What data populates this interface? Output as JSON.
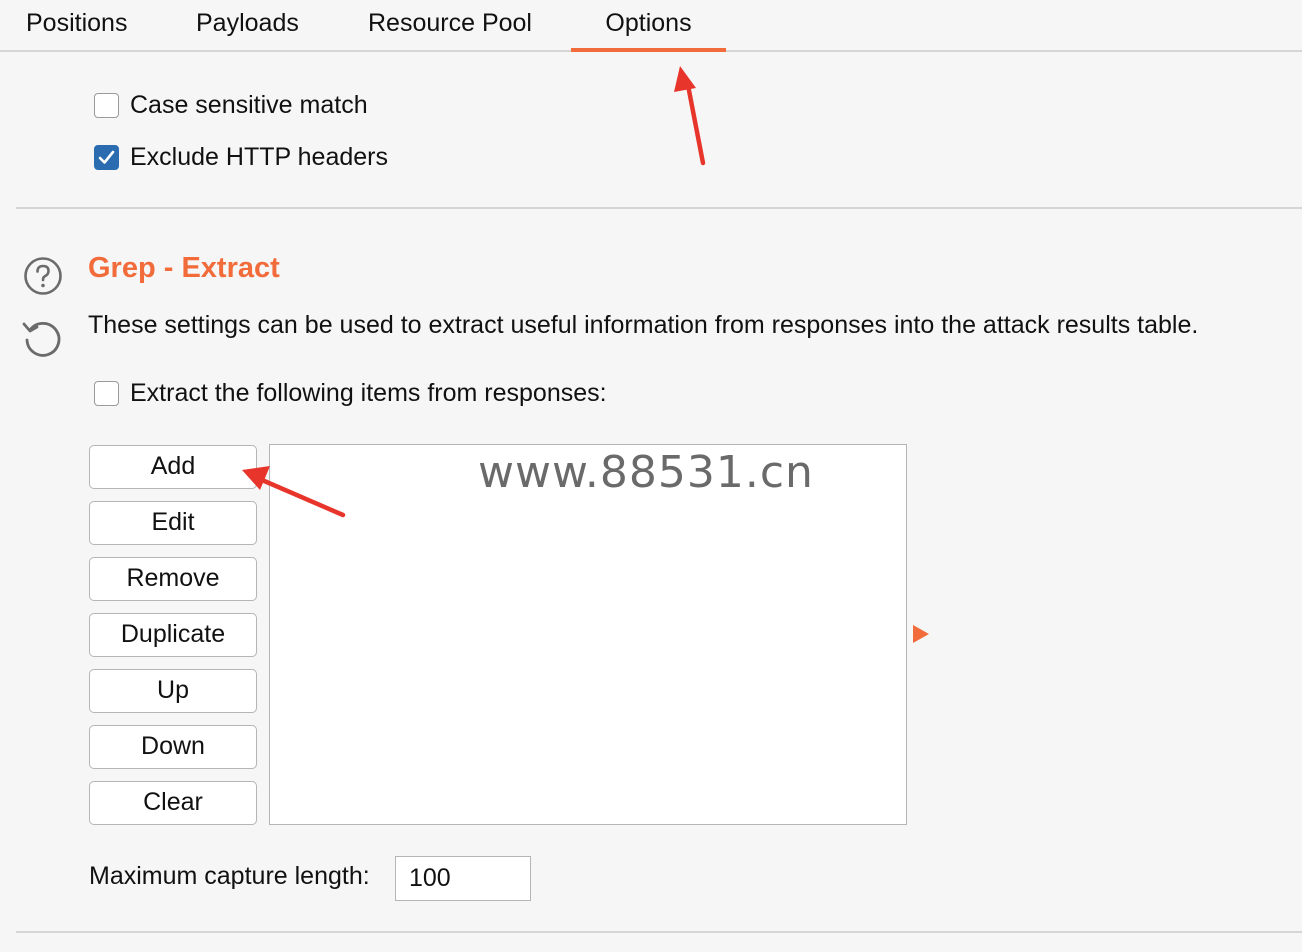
{
  "tabs": [
    {
      "label": "Positions",
      "active": false
    },
    {
      "label": "Payloads",
      "active": false
    },
    {
      "label": "Resource Pool",
      "active": false
    },
    {
      "label": "Options",
      "active": true
    }
  ],
  "options": {
    "case_sensitive": {
      "label": "Case sensitive match",
      "checked": false
    },
    "exclude_headers": {
      "label": "Exclude HTTP headers",
      "checked": true
    }
  },
  "grep_extract": {
    "title": "Grep - Extract",
    "description": "These settings can be used to extract useful information from responses into the attack results table.",
    "extract_checkbox": {
      "label": "Extract the following items from responses:",
      "checked": false
    },
    "buttons": {
      "add": "Add",
      "edit": "Edit",
      "remove": "Remove",
      "duplicate": "Duplicate",
      "up": "Up",
      "down": "Down",
      "clear": "Clear"
    },
    "items": [],
    "max_capture": {
      "label": "Maximum capture length:",
      "value": "100"
    }
  },
  "watermark": "www.88531.cn",
  "icons": {
    "help": "help-icon",
    "reset": "reset-icon",
    "expand": "expand-arrow-icon"
  },
  "colors": {
    "accent": "#f26b3a",
    "checkbox_checked": "#2b6cb0",
    "annotation_arrow": "#e8352b"
  }
}
